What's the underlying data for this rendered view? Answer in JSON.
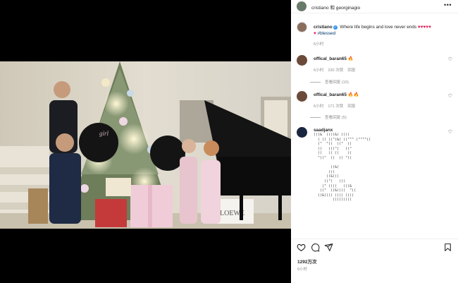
{
  "header": {
    "names": "cristiano 和 georginagio",
    "more": "•••"
  },
  "caption": {
    "username": "cristiano",
    "text": " Where life begins and love never ends ",
    "hearts": "♥♥♥♥♥",
    "hashtag_prefix": "♥ ",
    "hashtag": "#blessed",
    "time": "6小时"
  },
  "comments": [
    {
      "username": "offical_baran65",
      "emoji": "🔥",
      "time": "6小时",
      "likes": "230 次赞",
      "reply": "回复",
      "view_replies": "查看回复 (10)"
    },
    {
      "username": "offical_baran65",
      "emoji": "🔥🔥",
      "time": "6小时",
      "likes": "171 次赞",
      "reply": "回复",
      "view_replies": "查看回复 (5)"
    },
    {
      "username": "saadjanx",
      "ascii_art": "(((&  ((((&( ((((\n  ( (( ((\"(&( ((\"\"\" (\"\"\"\"((\n  (\"  \"((  ((\"  ((\n  ((   (((\"(   ((\"\n  ((   (( ((    ((\n  \"((\"  ((  (( \"((\n\n        ((&(\n       (((\n      ((&(((\n     ((\"(   (((\n    (\" ((((   (((&\n   ((\"  ((&((((  \"((\n  ((&(((( (((( ((((\n         ((((((((("
    }
  ],
  "actions": {
    "likes_count": "1292万次",
    "post_time": "6小时"
  }
}
